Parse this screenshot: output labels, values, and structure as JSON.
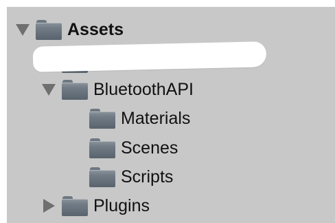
{
  "project_tree": {
    "items": [
      {
        "label": "Assets",
        "expanded": true,
        "icon": "folder-icon"
      },
      {
        "label": "",
        "expanded": false,
        "icon": "folder-icon",
        "redacted": true
      },
      {
        "label": "BluetoothAPI",
        "expanded": true,
        "icon": "folder-icon"
      },
      {
        "label": "Materials",
        "icon": "folder-icon"
      },
      {
        "label": "Scenes",
        "icon": "folder-icon"
      },
      {
        "label": "Scripts",
        "icon": "folder-icon"
      },
      {
        "label": "Plugins",
        "expanded": false,
        "icon": "folder-icon"
      }
    ]
  },
  "colors": {
    "panel_background": "#c8c8c8",
    "folder_icon": "#727c86",
    "disclosure_triangle": "#6f6f6f",
    "redaction": "#ffffff"
  }
}
